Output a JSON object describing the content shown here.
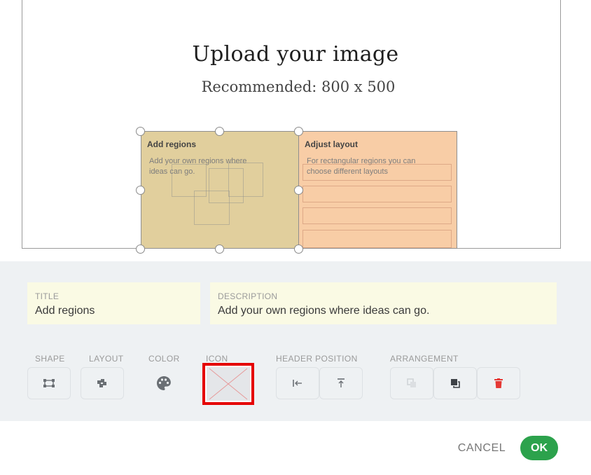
{
  "canvas": {
    "title": "Upload your image",
    "subtitle": "Recommended: 800 x 500"
  },
  "regions": [
    {
      "title": "Add regions",
      "description": "Add your own regions where ideas can go.",
      "color": "#e1cf9d"
    },
    {
      "title": "Adjust layout",
      "description": "For rectangular regions you can choose different layouts",
      "color": "#f8cda6"
    }
  ],
  "fields": {
    "title": {
      "label": "TITLE",
      "value": "Add regions"
    },
    "description": {
      "label": "DESCRIPTION",
      "value": "Add your own regions where ideas can go."
    }
  },
  "toolbar": {
    "shape_label": "SHAPE",
    "layout_label": "LAYOUT",
    "color_label": "COLOR",
    "icon_label": "ICON",
    "header_position_label": "HEADER POSITION",
    "arrangement_label": "ARRANGEMENT",
    "icons": {
      "shape": "shape-transform-icon",
      "layout": "layout-blocks-icon",
      "color": "palette-icon",
      "icon": "empty-image-icon",
      "header_left": "align-left-bar-icon",
      "header_top": "align-top-bar-icon",
      "send_back": "send-to-back-icon",
      "bring_front": "bring-to-front-icon",
      "delete": "trash-icon"
    }
  },
  "footer": {
    "cancel_label": "CANCEL",
    "ok_label": "OK"
  },
  "colors": {
    "accent_ok": "#2ca24c",
    "delete": "#e53935",
    "highlight_border": "#e50000",
    "panel_bg": "#eef1f3",
    "field_bg": "#fafae4"
  }
}
